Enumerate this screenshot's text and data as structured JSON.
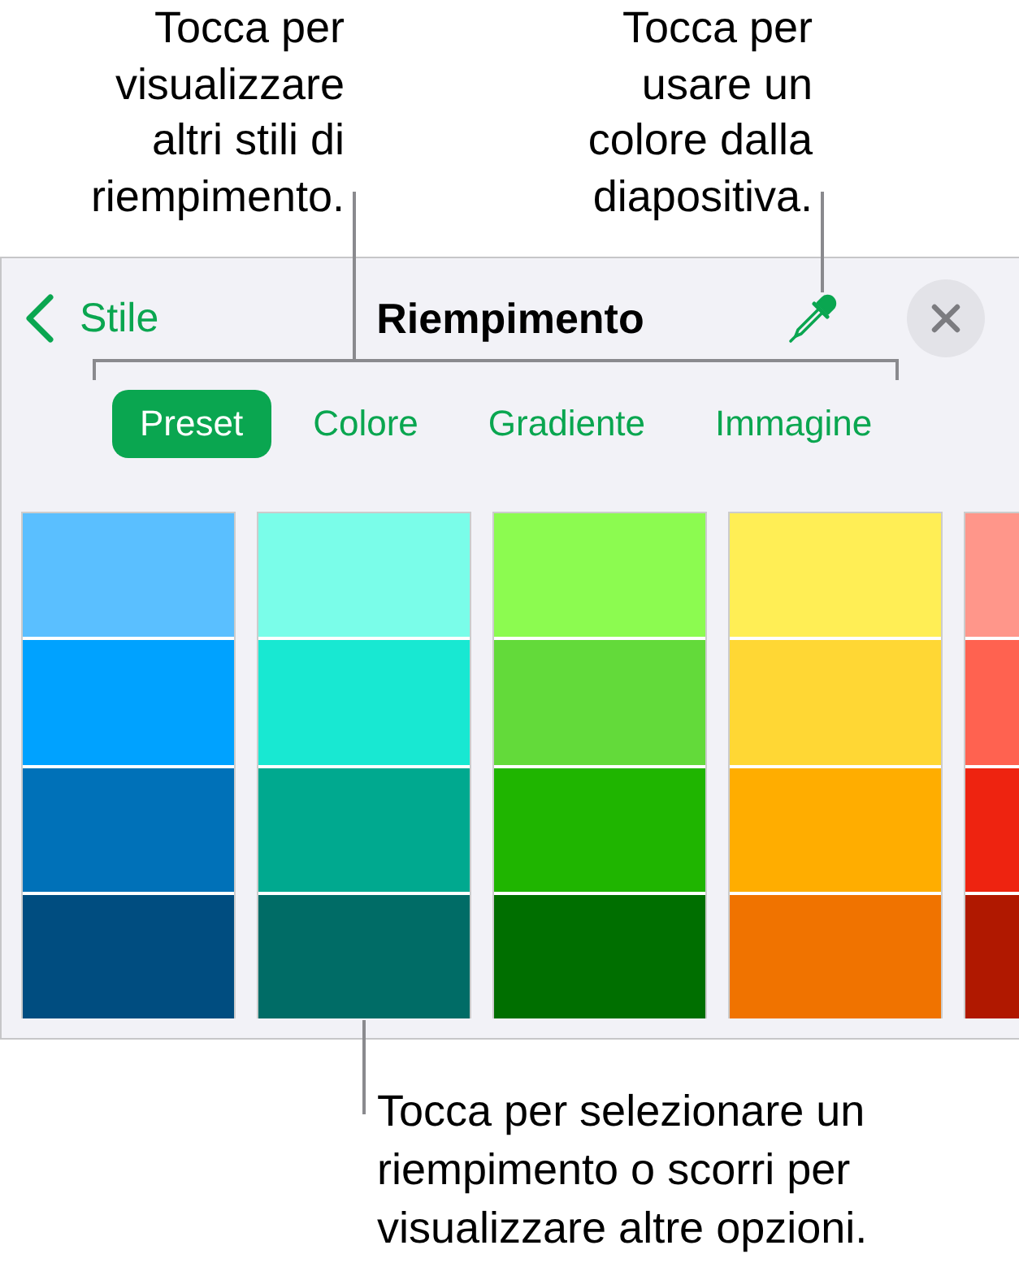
{
  "top_callouts": [
    {
      "text": "Tocca per\nvisualizzare\naltri stili di\nriempimento."
    },
    {
      "text": "Tocca per\nusare un\ncolore dalla\ndiapositiva."
    }
  ],
  "panel": {
    "back_button": {
      "label": "Stile"
    },
    "title": "Riempimento",
    "tabs": [
      {
        "label": "Preset",
        "selected": true
      },
      {
        "label": "Colore",
        "selected": false
      },
      {
        "label": "Gradiente",
        "selected": false
      },
      {
        "label": "Immagine",
        "selected": false
      }
    ],
    "swatch_columns": [
      {
        "swatches": [
          {
            "color": "#5abfff"
          },
          {
            "color": "#00a2ff"
          },
          {
            "color": "#0071b8"
          },
          {
            "color": "#004d80"
          }
        ]
      },
      {
        "swatches": [
          {
            "color": "#7afde9"
          },
          {
            "color": "#18e8d2"
          },
          {
            "color": "#00a98f"
          },
          {
            "color": "#006c66"
          }
        ]
      },
      {
        "swatches": [
          {
            "color": "#8cfb50"
          },
          {
            "color": "#63da3a"
          },
          {
            "color": "#1fb500"
          },
          {
            "color": "#006f00"
          }
        ]
      },
      {
        "swatches": [
          {
            "color": "#ffee55"
          },
          {
            "color": "#ffd734"
          },
          {
            "color": "#ffad00"
          },
          {
            "color": "#f07300"
          }
        ]
      },
      {
        "swatches": [
          {
            "color": "#ff968a"
          },
          {
            "color": "#ff6250"
          },
          {
            "color": "#ee2310"
          },
          {
            "color": "#b01800"
          }
        ]
      }
    ]
  },
  "bottom_callout": {
    "text": "Tocca per selezionare un\nriempimento o scorri per\nvisualizzare altre opzioni."
  }
}
